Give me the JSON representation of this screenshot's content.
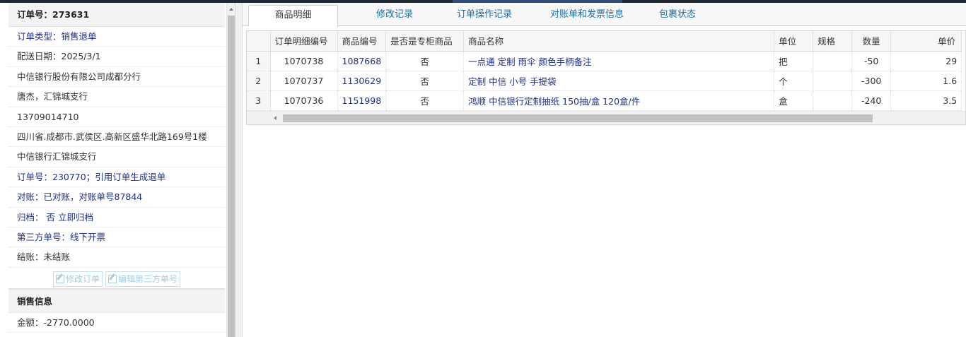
{
  "left_panel": {
    "order_header": "订单号：273631",
    "rows": [
      {
        "text": "订单类型：销售退单",
        "blue": true
      },
      {
        "text": "配送日期：2025/3/1",
        "blue": false
      },
      {
        "text": "中信银行股份有限公司成都分行",
        "blue": false
      },
      {
        "text": "唐杰，汇锦城支行",
        "blue": false
      },
      {
        "text": "13709014710",
        "blue": false
      },
      {
        "text": "四川省.成都市.武侯区.高新区盛华北路169号1楼",
        "blue": false
      },
      {
        "text": "中信银行汇锦城支行",
        "blue": false
      },
      {
        "text": "订单号：230770；引用订单生成退单",
        "blue": true
      },
      {
        "text": "对账：已对账，对账单号87844",
        "blue": true
      },
      {
        "text": "归档： 否 立即归档",
        "blue": true
      },
      {
        "text": "第三方单号：线下开票",
        "blue": true
      },
      {
        "text": "结账：未结账",
        "blue": false
      }
    ],
    "buttons": {
      "edit_order": "修改订单",
      "edit_third_party": "编辑第三方单号"
    },
    "sales_header": "销售信息",
    "amount": "金额：-2770.0000"
  },
  "tabs": [
    "商品明细",
    "修改记录",
    "订单操作记录",
    "对账单和发票信息",
    "包裹状态"
  ],
  "table": {
    "columns": [
      "",
      "订单明细编号",
      "商品编号",
      "是否是专柜商品",
      "商品名称",
      "单位",
      "规格",
      "数量",
      "单价"
    ],
    "rows": [
      {
        "n": "1",
        "detail_id": "1070738",
        "product_id": "1087668",
        "counter": "否",
        "name": "一点通 定制 雨伞 颜色手柄备注",
        "unit": "把",
        "spec": "",
        "qty": "-50",
        "price": "29"
      },
      {
        "n": "2",
        "detail_id": "1070737",
        "product_id": "1130629",
        "counter": "否",
        "name": "定制 中信 小号 手提袋",
        "unit": "个",
        "spec": "",
        "qty": "-300",
        "price": "1.6"
      },
      {
        "n": "3",
        "detail_id": "1070736",
        "product_id": "1151998",
        "counter": "否",
        "name": "鸿顺 中信银行定制抽纸 150抽/盒 120盒/件",
        "unit": "盒",
        "spec": "",
        "qty": "-240",
        "price": "3.5"
      }
    ]
  }
}
